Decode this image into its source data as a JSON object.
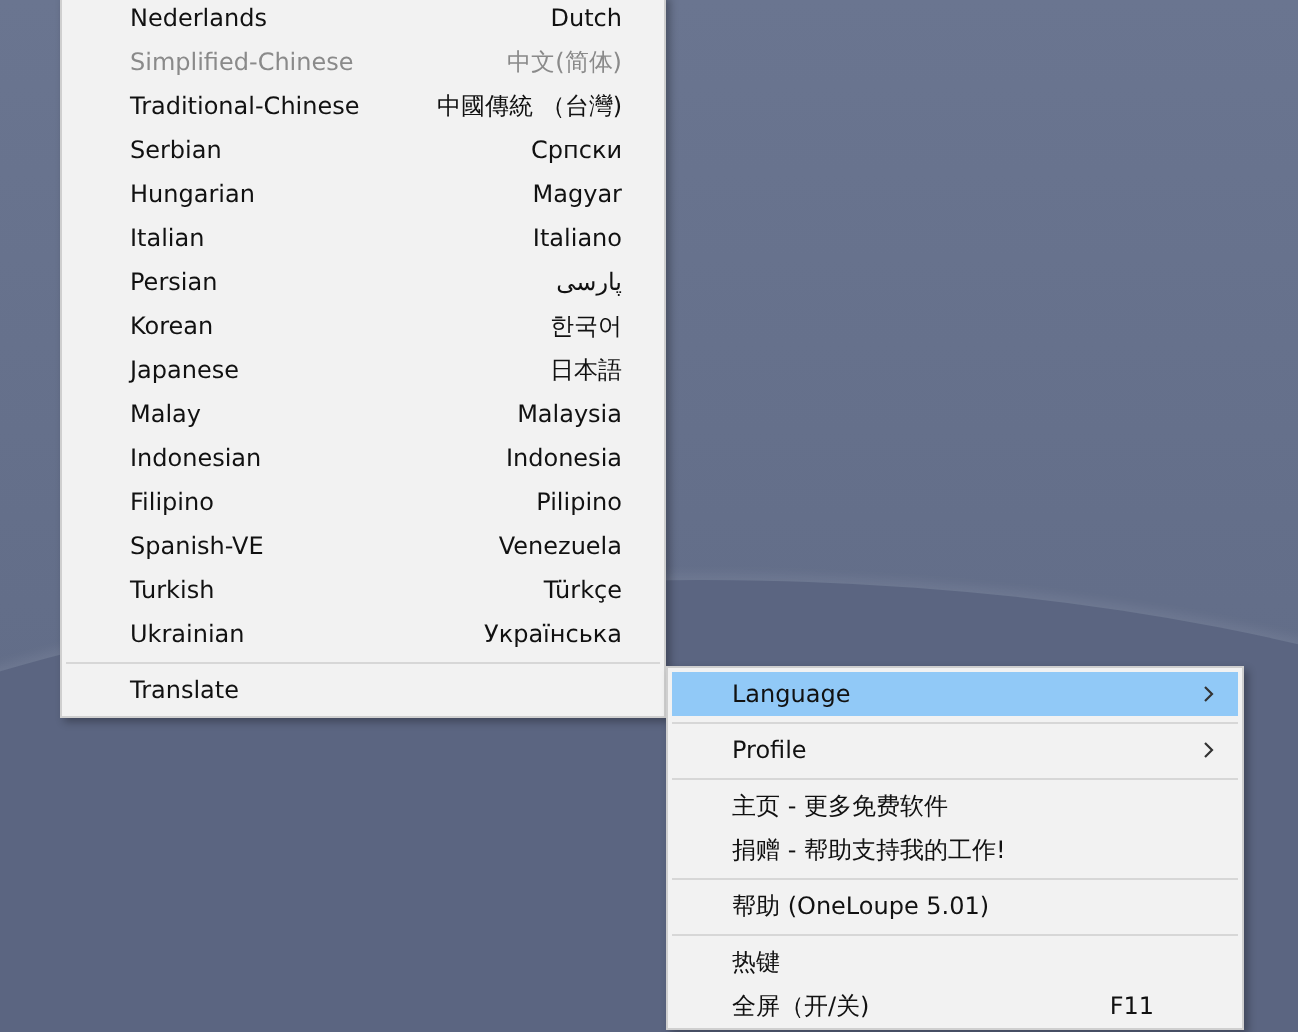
{
  "language_menu": {
    "items": [
      {
        "label": "Nederlands",
        "native": "Dutch",
        "disabled": false
      },
      {
        "label": "Simplified-Chinese",
        "native": "中文(简体)",
        "disabled": true
      },
      {
        "label": "Traditional-Chinese",
        "native": "中國傳統 （台灣)",
        "disabled": false
      },
      {
        "label": "Serbian",
        "native": "Српски",
        "disabled": false
      },
      {
        "label": "Hungarian",
        "native": "Magyar",
        "disabled": false
      },
      {
        "label": "Italian",
        "native": "Italiano",
        "disabled": false
      },
      {
        "label": "Persian",
        "native": "پارسی",
        "disabled": false
      },
      {
        "label": "Korean",
        "native": "한국어",
        "disabled": false
      },
      {
        "label": "Japanese",
        "native": "日本語",
        "disabled": false
      },
      {
        "label": "Malay",
        "native": "Malaysia",
        "disabled": false
      },
      {
        "label": "Indonesian",
        "native": "Indonesia",
        "disabled": false
      },
      {
        "label": "Filipino",
        "native": "Pilipino",
        "disabled": false
      },
      {
        "label": "Spanish-VE",
        "native": "Venezuela",
        "disabled": false
      },
      {
        "label": "Turkish",
        "native": "Türkçe",
        "disabled": false
      },
      {
        "label": "Ukrainian",
        "native": "Українська",
        "disabled": false
      }
    ],
    "footer_item": {
      "label": "Translate"
    }
  },
  "context_menu": {
    "items": [
      {
        "kind": "submenu",
        "label": "Language",
        "selected": true
      },
      {
        "kind": "separator"
      },
      {
        "kind": "submenu",
        "label": "Profile",
        "selected": false
      },
      {
        "kind": "separator"
      },
      {
        "kind": "item",
        "label": "主页 - 更多免费软件",
        "selected": false
      },
      {
        "kind": "item",
        "label": "捐赠 - 帮助支持我的工作!",
        "selected": false
      },
      {
        "kind": "separator"
      },
      {
        "kind": "item",
        "label": "帮助 (OneLoupe 5.01)",
        "selected": false
      },
      {
        "kind": "separator"
      },
      {
        "kind": "item",
        "label": "热键",
        "selected": false
      },
      {
        "kind": "item",
        "label": "全屏（开/关)",
        "shortcut": "F11",
        "selected": false
      }
    ]
  }
}
